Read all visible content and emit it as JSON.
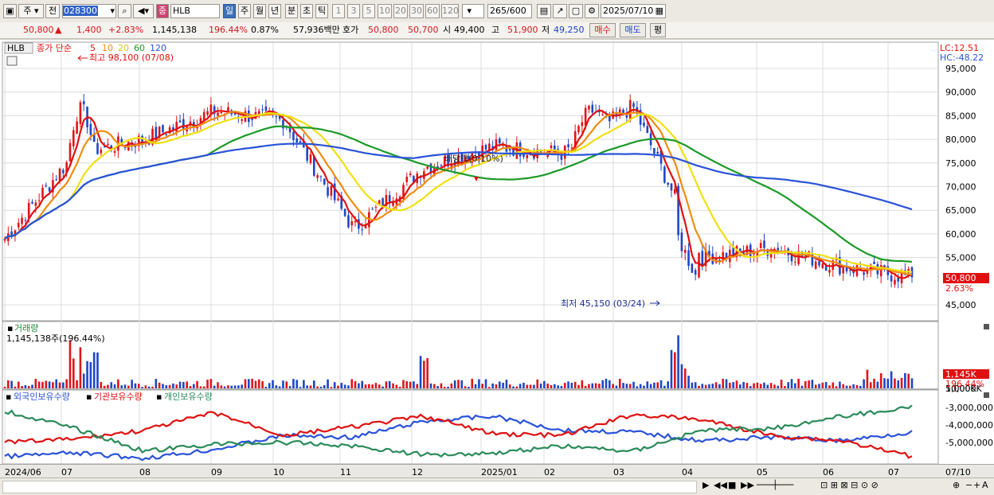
{
  "toolbar": {
    "market": "주",
    "type": "전",
    "code": "028300",
    "name": "HLB",
    "period_buttons": [
      "일",
      "주",
      "월",
      "년",
      "분",
      "초",
      "틱"
    ],
    "interval_buttons": [
      "1",
      "3",
      "5",
      "10",
      "20",
      "30",
      "60",
      "120"
    ],
    "count": "265",
    "count_max": "/600",
    "date": "2025/07/10"
  },
  "quote": {
    "price": "50,800",
    "change_arrow": "▲",
    "change": "1,400",
    "change_pct": "+2.83%",
    "volume": "1,145,138",
    "volume_ratio": "196.44%",
    "turnover": "0.87%",
    "amount": "57,936백만",
    "bid_label": "호가",
    "ask": "50,800",
    "bid": "50,700",
    "open_label": "시",
    "open": "49,400",
    "high_label": "고",
    "high": "51,900",
    "low_label": "저",
    "low": "49,250",
    "buy_label": "매수",
    "sell_label": "매도",
    "eval_label": "평"
  },
  "price_panel": {
    "stock_label": "HLB",
    "legend_prefix": "종가 단순",
    "ma_labels": [
      "5",
      "10",
      "20",
      "60",
      "120"
    ],
    "lc_label": "LC:12.51",
    "hc_label": "HC:-48.22",
    "high_annotation": "최고 98,100 (07/08)",
    "low_annotation": "최저 45,150 (03/24)",
    "dividend_annotation": "배당락(0.10%)",
    "current_price_tag": "50,800",
    "current_pct_tag": "2.63%",
    "y_ticks": [
      "95,000",
      "90,000",
      "85,000",
      "80,000",
      "75,000",
      "70,000",
      "65,000",
      "60,000",
      "55,000",
      "45,000"
    ]
  },
  "volume_panel": {
    "title": "거래량",
    "info": "1,145,138주(196.44%)",
    "y_ticks": [
      "10,000K",
      "5,000K"
    ],
    "current_tag": "1,145K",
    "current_pct": "196.44%"
  },
  "holder_panel": {
    "legend": [
      "외국인보유수량",
      "기관보유수량",
      "개인보유수량"
    ],
    "y_ticks": [
      "-3,000,000",
      "-4,000,000",
      "-5,000,000"
    ]
  },
  "x_axis": {
    "labels": [
      "2024/06",
      "07",
      "08",
      "09",
      "10",
      "11",
      "12",
      "2025/01",
      "02",
      "03",
      "04",
      "05",
      "06",
      "07"
    ],
    "right_label": "07/10"
  },
  "colors": {
    "up": "#e0141a",
    "down": "#1e46c8",
    "ma5": "#e01010",
    "ma10": "#f08c10",
    "ma20": "#f0e010",
    "ma60": "#1c9a28",
    "ma120": "#2a52d8",
    "foreigner": "#2a52d8",
    "institution": "#e01010",
    "individual": "#2a8a5a"
  },
  "chart_data": {
    "type": "line",
    "x": [
      "2024/06",
      "07",
      "08",
      "09",
      "10",
      "11",
      "12",
      "2025/01",
      "02",
      "03",
      "04",
      "05",
      "06",
      "07"
    ],
    "series": [
      {
        "values": [
          59000,
          77000,
          80000,
          86000,
          84000,
          61000,
          74000,
          78500,
          77000,
          87000,
          55000,
          57000,
          53000,
          50800
        ]
      }
    ],
    "ylim": [
      43000,
      98000
    ]
  }
}
